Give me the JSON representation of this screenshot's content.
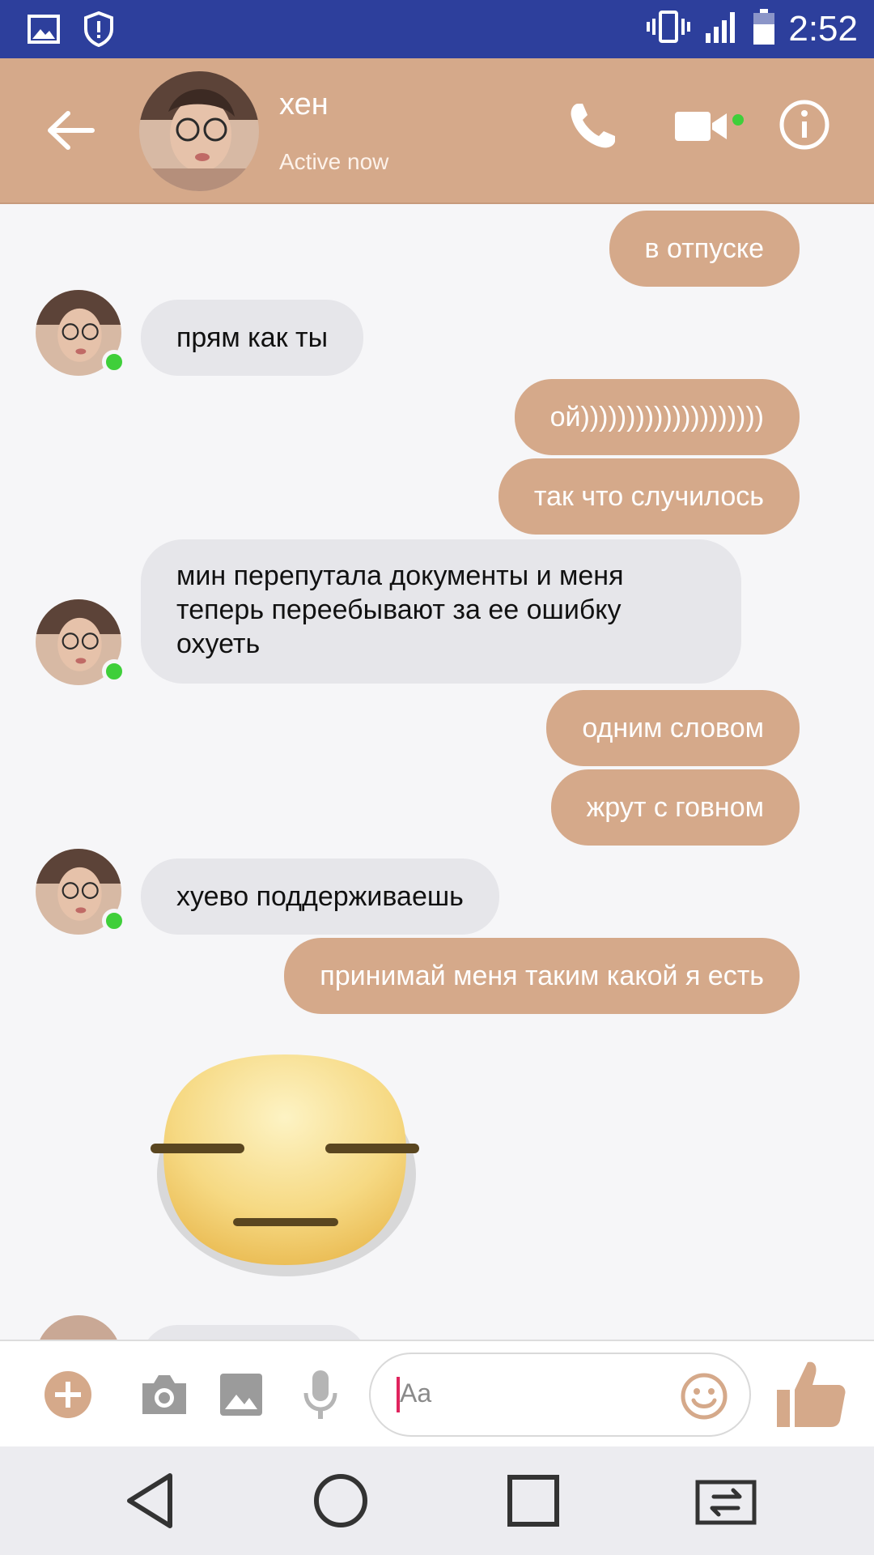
{
  "status_bar": {
    "time": "2:52"
  },
  "header": {
    "contact_name": "хен",
    "status": "Active now"
  },
  "messages": [
    {
      "dir": "out",
      "text": "в отпуске"
    },
    {
      "dir": "in",
      "text": "прям как ты"
    },
    {
      "dir": "out",
      "text": "ой))))))))))))))))))))"
    },
    {
      "dir": "out",
      "text": "так что случилось"
    },
    {
      "dir": "in",
      "lines": [
        "мин перепутала документы и меня",
        "теперь переебывают за ее ошибку",
        "охуеть"
      ]
    },
    {
      "dir": "out",
      "text": "одним словом"
    },
    {
      "dir": "out",
      "text": "жрут с говном"
    },
    {
      "dir": "in",
      "text": "хуево поддерживаешь"
    },
    {
      "dir": "out",
      "text": "принимай меня таким какой я есть"
    }
  ],
  "sticker": "expressionless-face-sticker",
  "composer": {
    "placeholder": "Aa"
  },
  "colors": {
    "accent": "#d5a98a",
    "status_bar": "#2d3f9c",
    "online": "#3fcf3a",
    "incoming_bubble": "#e6e6ea"
  }
}
